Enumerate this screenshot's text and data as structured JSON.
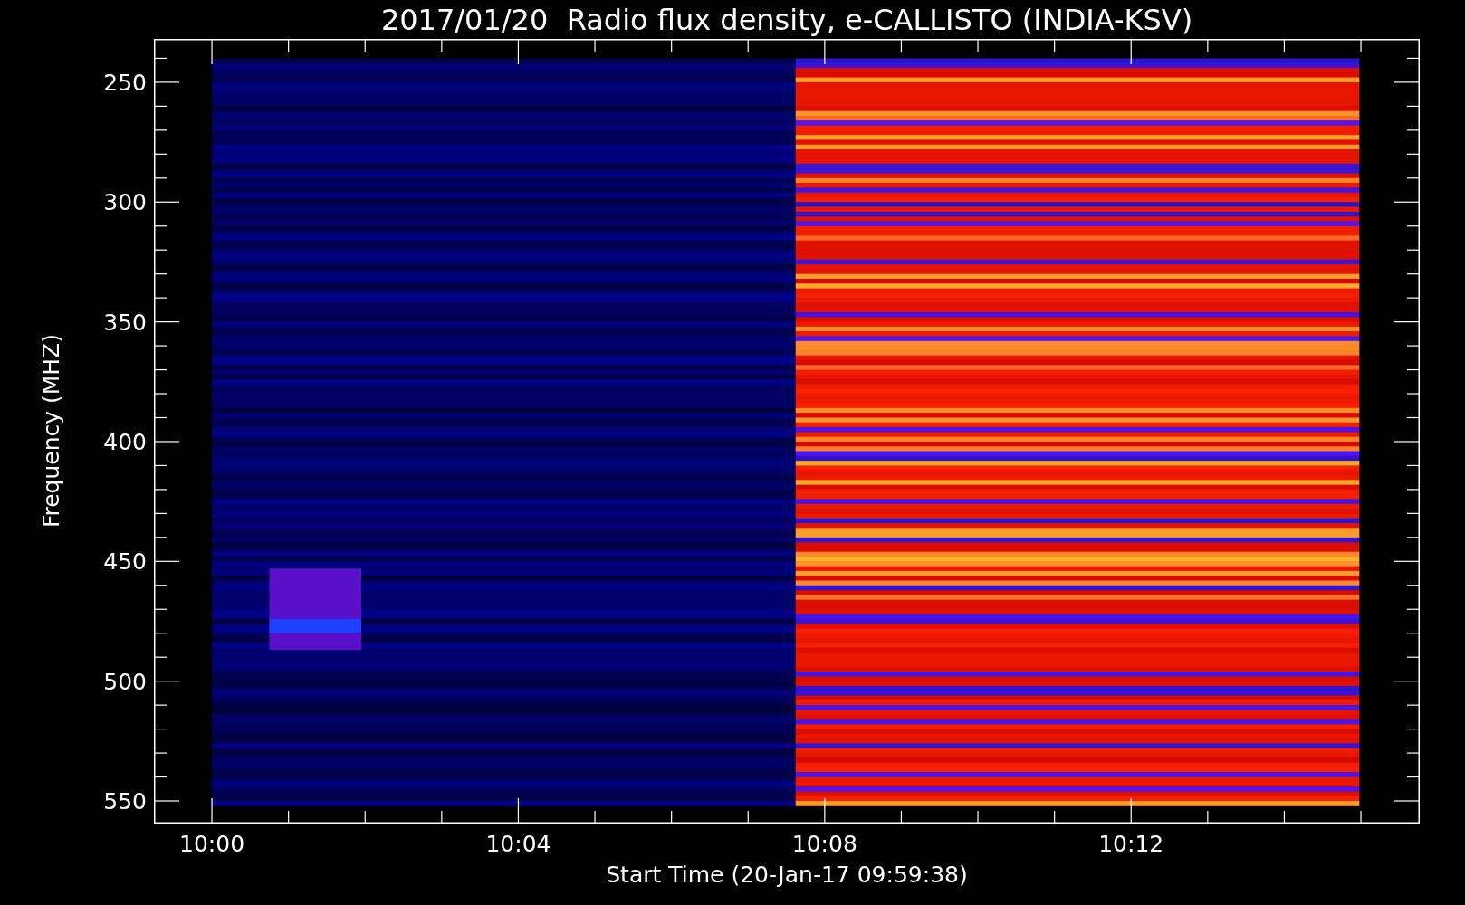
{
  "plot": {
    "title": "2017/01/20  Radio flux density, e-CALLISTO (INDIA-KSV)",
    "ylabel": "Frequency (MHZ)",
    "xlabel": "Start Time (20-Jan-17 09:59:38)",
    "yticks": [
      {
        "label": "250"
      },
      {
        "label": "300"
      },
      {
        "label": "350"
      },
      {
        "label": "400"
      },
      {
        "label": "450"
      },
      {
        "label": "500"
      },
      {
        "label": "550"
      }
    ],
    "xticks": [
      {
        "label": "10:00"
      },
      {
        "label": "10:04"
      },
      {
        "label": "10:08"
      },
      {
        "label": "10:12"
      }
    ]
  }
}
